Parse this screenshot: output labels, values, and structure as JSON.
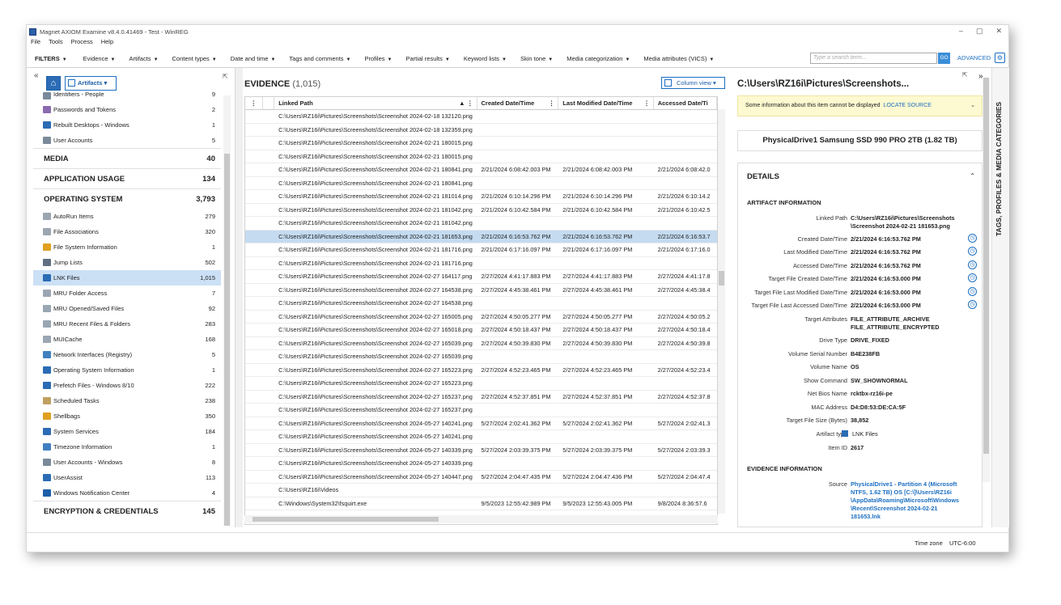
{
  "window": {
    "title": "Magnet AXIOM Examine v8.4.0.41469 - Test - WinREG",
    "controls": [
      "–",
      "▢",
      "✕"
    ]
  },
  "menu": [
    "File",
    "Tools",
    "Process",
    "Help"
  ],
  "toolbar": {
    "filters_label": "FILTERS",
    "items": [
      "Evidence",
      "Artifacts",
      "Content types",
      "Date and time",
      "Tags and comments",
      "Profiles",
      "Partial results",
      "Keyword lists",
      "Skin tone",
      "Media categorization",
      "Media attributes (VICS)"
    ],
    "search_placeholder": "Type a search term...",
    "go_label": "GO",
    "advanced_label": "ADVANCED"
  },
  "left": {
    "artifacts_dropdown": "Artifacts",
    "top_items": [
      {
        "label": "Identifiers - People",
        "count": "9",
        "color": "#7a8a9a"
      },
      {
        "label": "Passwords and Tokens",
        "count": "2",
        "color": "#8a6ab0"
      },
      {
        "label": "Rebuilt Desktops - Windows",
        "count": "1",
        "color": "#2b6cb5"
      },
      {
        "label": "User Accounts",
        "count": "5",
        "color": "#7a8a9a"
      }
    ],
    "categories": [
      {
        "label": "MEDIA",
        "count": "40"
      },
      {
        "label": "APPLICATION USAGE",
        "count": "134"
      },
      {
        "label": "OPERATING SYSTEM",
        "count": "3,793"
      }
    ],
    "os_items": [
      {
        "label": "AutoRun Items",
        "count": "279",
        "color": "#9aa6b2"
      },
      {
        "label": "File Associations",
        "count": "320",
        "color": "#9aa6b2"
      },
      {
        "label": "File System Information",
        "count": "1",
        "color": "#e0a020"
      },
      {
        "label": "Jump Lists",
        "count": "502",
        "color": "#607080"
      },
      {
        "label": "LNK Files",
        "count": "1,015",
        "color": "#2b6cb5"
      },
      {
        "label": "MRU Folder Access",
        "count": "7",
        "color": "#9aa6b2"
      },
      {
        "label": "MRU Opened/Saved Files",
        "count": "92",
        "color": "#9aa6b2"
      },
      {
        "label": "MRU Recent Files & Folders",
        "count": "283",
        "color": "#9aa6b2"
      },
      {
        "label": "MUICache",
        "count": "168",
        "color": "#9aa6b2"
      },
      {
        "label": "Network Interfaces (Registry)",
        "count": "5",
        "color": "#4080c0"
      },
      {
        "label": "Operating System Information",
        "count": "1",
        "color": "#2b6cb5"
      },
      {
        "label": "Prefetch Files - Windows 8/10",
        "count": "222",
        "color": "#2b6cb5"
      },
      {
        "label": "Scheduled Tasks",
        "count": "238",
        "color": "#c0a060"
      },
      {
        "label": "Shellbags",
        "count": "350",
        "color": "#e0a020"
      },
      {
        "label": "System Services",
        "count": "184",
        "color": "#2b6cb5"
      },
      {
        "label": "Timezone Information",
        "count": "1",
        "color": "#4080c0"
      },
      {
        "label": "User Accounts - Windows",
        "count": "8",
        "color": "#7a8a9a"
      },
      {
        "label": "UserAssist",
        "count": "113",
        "color": "#2b6cb5"
      },
      {
        "label": "Windows Notification Center",
        "count": "4",
        "color": "#1c5fa8"
      }
    ],
    "bottom_category": {
      "label": "ENCRYPTION & CREDENTIALS",
      "count": "145"
    }
  },
  "evidence": {
    "title": "EVIDENCE",
    "count": "(1,015)",
    "column_view": "Column view",
    "columns": [
      "Linked Path",
      "Created Date/Time",
      "Last Modified Date/Time",
      "Accessed Date/Ti"
    ],
    "rows": [
      [
        "C:\\Users\\RZ16i\\Pictures\\Screenshots\\Screenshot 2024-02-18 132120.png",
        "",
        "",
        ""
      ],
      [
        "C:\\Users\\RZ16i\\Pictures\\Screenshots\\Screenshot 2024-02-18 132359.png",
        "",
        "",
        ""
      ],
      [
        "C:\\Users\\RZ16i\\Pictures\\Screenshots\\Screenshot 2024-02-21 180015.png",
        "",
        "",
        ""
      ],
      [
        "C:\\Users\\RZ16i\\Pictures\\Screenshots\\Screenshot 2024-02-21 180015.png",
        "",
        "",
        ""
      ],
      [
        "C:\\Users\\RZ16i\\Pictures\\Screenshots\\Screenshot 2024-02-21 180841.png",
        "2/21/2024 6:08:42.003 PM",
        "2/21/2024 6:08:42.003 PM",
        "2/21/2024 6:08:42.0"
      ],
      [
        "C:\\Users\\RZ16i\\Pictures\\Screenshots\\Screenshot 2024-02-21 180841.png",
        "",
        "",
        ""
      ],
      [
        "C:\\Users\\RZ16i\\Pictures\\Screenshots\\Screenshot 2024-02-21 181014.png",
        "2/21/2024 6:10:14.296 PM",
        "2/21/2024 6:10:14.296 PM",
        "2/21/2024 6:10:14.2"
      ],
      [
        "C:\\Users\\RZ16i\\Pictures\\Screenshots\\Screenshot 2024-02-21 181042.png",
        "2/21/2024 6:10:42.584 PM",
        "2/21/2024 6:10:42.584 PM",
        "2/21/2024 6:10:42.5"
      ],
      [
        "C:\\Users\\RZ16i\\Pictures\\Screenshots\\Screenshot 2024-02-21 181042.png",
        "",
        "",
        ""
      ],
      [
        "C:\\Users\\RZ16i\\Pictures\\Screenshots\\Screenshot 2024-02-21 181653.png",
        "2/21/2024 6:16:53.762 PM",
        "2/21/2024 6:16:53.762 PM",
        "2/21/2024 6:16:53.7"
      ],
      [
        "C:\\Users\\RZ16i\\Pictures\\Screenshots\\Screenshot 2024-02-21 181716.png",
        "2/21/2024 6:17:16.097 PM",
        "2/21/2024 6:17:16.097 PM",
        "2/21/2024 6:17:16.0"
      ],
      [
        "C:\\Users\\RZ16i\\Pictures\\Screenshots\\Screenshot 2024-02-21 181716.png",
        "",
        "",
        ""
      ],
      [
        "C:\\Users\\RZ16i\\Pictures\\Screenshots\\Screenshot 2024-02-27 164117.png",
        "2/27/2024 4:41:17.883 PM",
        "2/27/2024 4:41:17.883 PM",
        "2/27/2024 4:41:17.8"
      ],
      [
        "C:\\Users\\RZ16i\\Pictures\\Screenshots\\Screenshot 2024-02-27 164538.png",
        "2/27/2024 4:45:38.461 PM",
        "2/27/2024 4:45:38.461 PM",
        "2/27/2024 4:45:38.4"
      ],
      [
        "C:\\Users\\RZ16i\\Pictures\\Screenshots\\Screenshot 2024-02-27 164538.png",
        "",
        "",
        ""
      ],
      [
        "C:\\Users\\RZ16i\\Pictures\\Screenshots\\Screenshot 2024-02-27 165005.png",
        "2/27/2024 4:50:05.277 PM",
        "2/27/2024 4:50:05.277 PM",
        "2/27/2024 4:50:05.2"
      ],
      [
        "C:\\Users\\RZ16i\\Pictures\\Screenshots\\Screenshot 2024-02-27 165018.png",
        "2/27/2024 4:50:18.437 PM",
        "2/27/2024 4:50:18.437 PM",
        "2/27/2024 4:50:18.4"
      ],
      [
        "C:\\Users\\RZ16i\\Pictures\\Screenshots\\Screenshot 2024-02-27 165039.png",
        "2/27/2024 4:50:39.830 PM",
        "2/27/2024 4:50:39.830 PM",
        "2/27/2024 4:50:39.8"
      ],
      [
        "C:\\Users\\RZ16i\\Pictures\\Screenshots\\Screenshot 2024-02-27 165039.png",
        "",
        "",
        ""
      ],
      [
        "C:\\Users\\RZ16i\\Pictures\\Screenshots\\Screenshot 2024-02-27 165223.png",
        "2/27/2024 4:52:23.465 PM",
        "2/27/2024 4:52:23.465 PM",
        "2/27/2024 4:52:23.4"
      ],
      [
        "C:\\Users\\RZ16i\\Pictures\\Screenshots\\Screenshot 2024-02-27 165223.png",
        "",
        "",
        ""
      ],
      [
        "C:\\Users\\RZ16i\\Pictures\\Screenshots\\Screenshot 2024-02-27 165237.png",
        "2/27/2024 4:52:37.851 PM",
        "2/27/2024 4:52:37.851 PM",
        "2/27/2024 4:52:37.8"
      ],
      [
        "C:\\Users\\RZ16i\\Pictures\\Screenshots\\Screenshot 2024-02-27 165237.png",
        "",
        "",
        ""
      ],
      [
        "C:\\Users\\RZ16i\\Pictures\\Screenshots\\Screenshot 2024-05-27 140241.png",
        "5/27/2024 2:02:41.362 PM",
        "5/27/2024 2:02:41.362 PM",
        "5/27/2024 2:02:41.3"
      ],
      [
        "C:\\Users\\RZ16i\\Pictures\\Screenshots\\Screenshot 2024-05-27 140241.png",
        "",
        "",
        ""
      ],
      [
        "C:\\Users\\RZ16i\\Pictures\\Screenshots\\Screenshot 2024-05-27 140339.png",
        "5/27/2024 2:03:39.375 PM",
        "5/27/2024 2:03:39.375 PM",
        "5/27/2024 2:03:39.3"
      ],
      [
        "C:\\Users\\RZ16i\\Pictures\\Screenshots\\Screenshot 2024-05-27 140339.png",
        "",
        "",
        ""
      ],
      [
        "C:\\Users\\RZ16i\\Pictures\\Screenshots\\Screenshot 2024-05-27 140447.png",
        "5/27/2024 2:04:47.435 PM",
        "5/27/2024 2:04:47.436 PM",
        "5/27/2024 2:04:47.4"
      ],
      [
        "C:\\Users\\RZ16i\\Videos",
        "",
        "",
        ""
      ],
      [
        "C:\\Windows\\System32\\fsquirt.exe",
        "9/5/2023 12:55:42.989 PM",
        "9/5/2023 12:55:43.005 PM",
        "9/8/2024 8:36:57.6"
      ]
    ],
    "selected_row": 9
  },
  "details": {
    "title": "C:\\Users\\RZ16i\\Pictures\\Screenshots...",
    "warning": "Some information about this item cannot be displayed",
    "locate_source": "LOCATE SOURCE",
    "drive": "PhysicalDrive1 Samsung SSD 990 PRO 2TB (1.82 TB)",
    "details_heading": "DETAILS",
    "artifact_info_heading": "ARTIFACT INFORMATION",
    "fields": [
      {
        "label": "Linked Path",
        "value": "C:\\Users\\RZ16i\\Pictures\\Screenshots\n\\Screenshot 2024-02-21 181653.png",
        "clock": false
      },
      {
        "label": "Created Date/Time",
        "value": "2/21/2024 6:16:53.762 PM",
        "clock": true
      },
      {
        "label": "Last Modified Date/Time",
        "value": "2/21/2024 6:16:53.762 PM",
        "clock": true
      },
      {
        "label": "Accessed Date/Time",
        "value": "2/21/2024 6:16:53.762 PM",
        "clock": true
      },
      {
        "label": "Target File Created Date/Time",
        "value": "2/21/2024 6:16:53.000 PM",
        "clock": true
      },
      {
        "label": "Target File Last Modified Date/Time",
        "value": "2/21/2024 6:16:53.000 PM",
        "clock": true
      },
      {
        "label": "Target File Last Accessed Date/Time",
        "value": "2/21/2024 6:16:53.000 PM",
        "clock": true
      },
      {
        "label": "Target Attributes",
        "value": "FILE_ATTRIBUTE_ARCHIVE\nFILE_ATTRIBUTE_ENCRYPTED",
        "clock": false
      },
      {
        "label": "Drive Type",
        "value": "DRIVE_FIXED",
        "clock": false
      },
      {
        "label": "Volume Serial Number",
        "value": "B4E238FB",
        "clock": false
      },
      {
        "label": "Volume Name",
        "value": "OS",
        "clock": false
      },
      {
        "label": "Show Command",
        "value": "SW_SHOWNORMAL",
        "clock": false
      },
      {
        "label": "Net Bios Name",
        "value": "rcktbx-rz16i-pe",
        "clock": false
      },
      {
        "label": "MAC Address",
        "value": "D4:D8:53:DE:CA:5F",
        "clock": false
      },
      {
        "label": "Target File Size (Bytes)",
        "value": "38,852",
        "clock": false
      },
      {
        "label": "Artifact type",
        "value": "LNK Files",
        "clock": false
      },
      {
        "label": "Item ID",
        "value": "2617",
        "clock": false
      }
    ],
    "evidence_info_heading": "EVIDENCE INFORMATION",
    "source_label": "Source",
    "source_value": "PhysicalDrive1 - Partition 4 (Microsoft\nNTFS, 1.62 TB) OS [C:\\]\\Users\\RZ16i\n\\AppData\\Roaming\\Microsoft\\Windows\n\\Recent\\Screenshot 2024-02-21\n181653.lnk"
  },
  "side_rail": "TAGS, PROFILES & MEDIA CATEGORIES",
  "status": {
    "timezone_label": "Time zone",
    "timezone_value": "UTC-6:00"
  }
}
